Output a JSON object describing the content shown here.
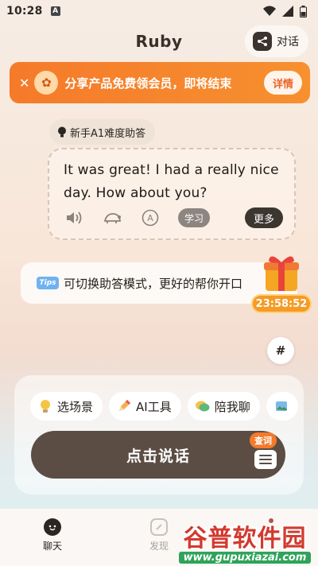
{
  "status_bar": {
    "time": "10:28",
    "notif_glyph": "A"
  },
  "header": {
    "title": "Ruby",
    "chat_toggle_label": "对话",
    "chat_toggle_icon": "share-icon"
  },
  "banner": {
    "text": "分享产品免费领会员，即将结束",
    "button_label": "详情",
    "close_glyph": "✕",
    "logo_glyph": "✿"
  },
  "assistant": {
    "level_label": "新手A1难度助答",
    "message": "It was great! I had a really nice day. How about you?",
    "actions": [
      "speaker-icon",
      "turtle-icon",
      "translate-icon"
    ],
    "translate_glyph": "A",
    "learn_label": "学习",
    "more_label": "更多"
  },
  "tips": {
    "tag": "Tips",
    "text": "可切换助答模式，更好的帮你开口"
  },
  "promo": {
    "countdown": "23:58:52"
  },
  "hash_glyph": "#",
  "composer": {
    "chips": [
      {
        "label": "选场景",
        "icon": "lightbulb-icon"
      },
      {
        "label": "AI工具",
        "icon": "pencil-icon"
      },
      {
        "label": "陪我聊",
        "icon": "chat-bubbles-icon"
      }
    ],
    "speak_label": "点击说话",
    "dict_tag": "查词"
  },
  "tabbar": {
    "tabs": [
      {
        "label": "聊天",
        "active": true
      },
      {
        "label": "发现",
        "active": false
      }
    ]
  },
  "watermark": {
    "brand": "谷普软件园",
    "url": "www.gupuxiazai.com"
  },
  "colors": {
    "accent": "#f57a2a",
    "dark_button": "#5b4d43",
    "tips_blue": "#6fb2f0"
  }
}
